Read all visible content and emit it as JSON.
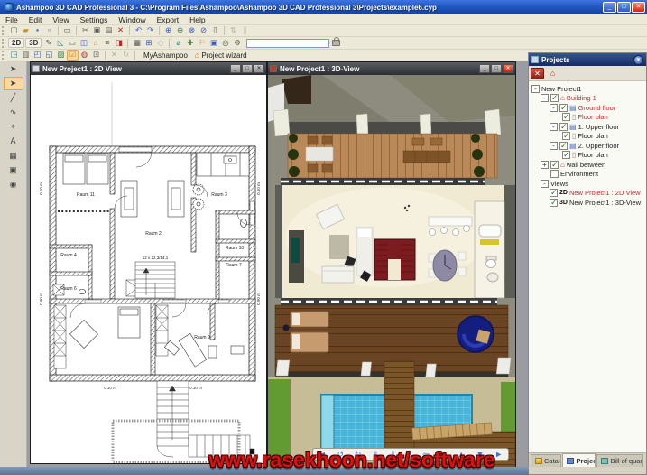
{
  "app": {
    "title": "Ashampoo 3D CAD Professional 3 - C:\\Program Files\\Ashampoo\\Ashampoo 3D CAD Professional 3\\Projects\\example6.cyp",
    "controls": {
      "minimize": "_",
      "maximize": "□",
      "close": "✕"
    }
  },
  "menu": {
    "file": "File",
    "edit": "Edit",
    "view": "View",
    "settings": "Settings",
    "window": "Window",
    "export": "Export",
    "help": "Help"
  },
  "toolbar1": {
    "icons": [
      "▢",
      "▰",
      "▪",
      "▫",
      "▭",
      "✂",
      "▣",
      "▤",
      "✕",
      "↶",
      "↷",
      "⊕",
      "⊖",
      "⊗",
      "⊘",
      "▯",
      "⇅",
      "∥"
    ]
  },
  "toolbar2": {
    "view2d": "2D",
    "view3d": "3D",
    "field_value": "",
    "icons": [
      "✎",
      "◺",
      "▭",
      "◫",
      "⌂",
      "≡",
      "◨",
      "▦",
      "⊞",
      "◇",
      "⌀",
      "✚",
      "⚐",
      "▣",
      "◎",
      "⚙"
    ]
  },
  "toolbar3": {
    "icons": [
      "◳",
      "▥",
      "◰",
      "◱",
      "▨",
      "☑",
      "◍",
      "⊡",
      "✕",
      "↻"
    ],
    "myashampoo": "MyAshampoo",
    "project_wizard": "Project wizard"
  },
  "left_toolbar": {
    "icons": [
      "➤",
      "➤",
      "╱",
      "∿",
      "⌖",
      "A",
      "▦",
      "▣",
      "◉"
    ]
  },
  "view2d": {
    "title": "New Project1 : 2D View",
    "rooms": {
      "r11": "Raum 11",
      "r2": "Raum 2",
      "r3": "Raum 3",
      "r4": "Raum 4",
      "r6": "Raum 6",
      "r7": "Raum 7",
      "r9": "Raum 9",
      "r10": "Raum 10"
    },
    "stair_label": "12 x 22,3/14,1",
    "dims": {
      "bottom_left": "0.10 m",
      "bottom_right": "0.10 m",
      "left_top": "0.10 m",
      "left_bottom": "0.90 m",
      "right_top": "0.10 m",
      "right_bottom": "0.90 m"
    }
  },
  "view3d": {
    "title": "New Project1 : 3D-View",
    "nav_icons": [
      "◄",
      "↺",
      "↻",
      "⇧",
      "⇩",
      "⌂",
      "⇦",
      "⇨",
      "▲",
      "▼",
      "►"
    ]
  },
  "projects_panel": {
    "title": "Projects",
    "tree": [
      {
        "expander": "-",
        "label": "New Project1"
      },
      {
        "expander": "-",
        "checked": true,
        "icon": "⌂",
        "label": "Building 1",
        "state": "red"
      },
      {
        "expander": "-",
        "checked": true,
        "icon": "▤",
        "label": "Ground floor",
        "state": "red"
      },
      {
        "checked": true,
        "icon": "▯",
        "label": "Floor plan",
        "state": "red"
      },
      {
        "expander": "-",
        "checked": true,
        "icon": "▤",
        "label": "1. Upper floor"
      },
      {
        "checked": true,
        "icon": "▯",
        "label": "Floor plan"
      },
      {
        "expander": "-",
        "checked": true,
        "icon": "▤",
        "label": "2. Upper floor"
      },
      {
        "checked": true,
        "icon": "▯",
        "label": "Floor plan"
      },
      {
        "expander": "+",
        "checked": true,
        "icon": "⌂",
        "label": "wall between"
      },
      {
        "checked": false,
        "label": "Environment"
      },
      {
        "expander": "-",
        "label": "Views"
      },
      {
        "checked": true,
        "icon": "2D",
        "label": "New Project1 : 2D View",
        "state": "red"
      },
      {
        "checked": true,
        "icon": "3D",
        "label": "New Project1 : 3D-View"
      }
    ],
    "tabs": {
      "catalog": "Catalog",
      "projects": "Projects",
      "bill": "Bill of quantiti..."
    }
  },
  "watermark": {
    "text": "www.rasekhoon.net/software",
    "color": "#de1111"
  },
  "colors": {
    "titlebar_blue": "#2158c2",
    "tree_red": "#c22f2f",
    "mdi_gray": "#9b9ca2"
  }
}
